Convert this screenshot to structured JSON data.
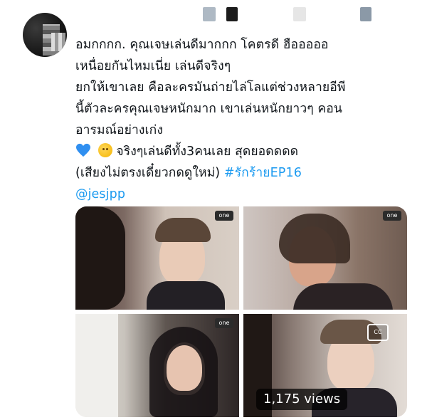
{
  "tweet": {
    "lines": [
      "อมกกกก. คุณเจษเล่นดีมากกก โคตรดี ฮือออออ",
      "เหนื่อยกันไหมเนี่ย เล่นดีจริงๆ",
      "ยกให้เขาเลย คือละครมันถ่ายไล่โลแต่ช่วงหลายอีพี",
      "นี้ตัวละครคุณเจษหนักมาก เขาเล่นหนักยาวๆ คอน",
      "อารมณ์อย่างเก่ง"
    ],
    "emoji_line_text": "จริงๆเล่นดีทั้ง3คนเลย สุดยอดดดด",
    "last_line_text": "(เสียงไม่ตรงเดี๋ยวกดดูใหม่) ",
    "hashtag": "#รักร้ายEP16",
    "mention": "@jesjpp",
    "emoji_heart": "blue-heart-icon",
    "emoji_face": "saluting-face-icon"
  },
  "media": {
    "views": "1,175 views",
    "channel_badge": "one",
    "cc_badge": "CC",
    "tiles": [
      {
        "name": "media-tile-1"
      },
      {
        "name": "media-tile-2"
      },
      {
        "name": "media-tile-3"
      },
      {
        "name": "media-tile-4"
      }
    ]
  },
  "colors": {
    "link": "#1d9bf0",
    "text": "#0f1419"
  }
}
